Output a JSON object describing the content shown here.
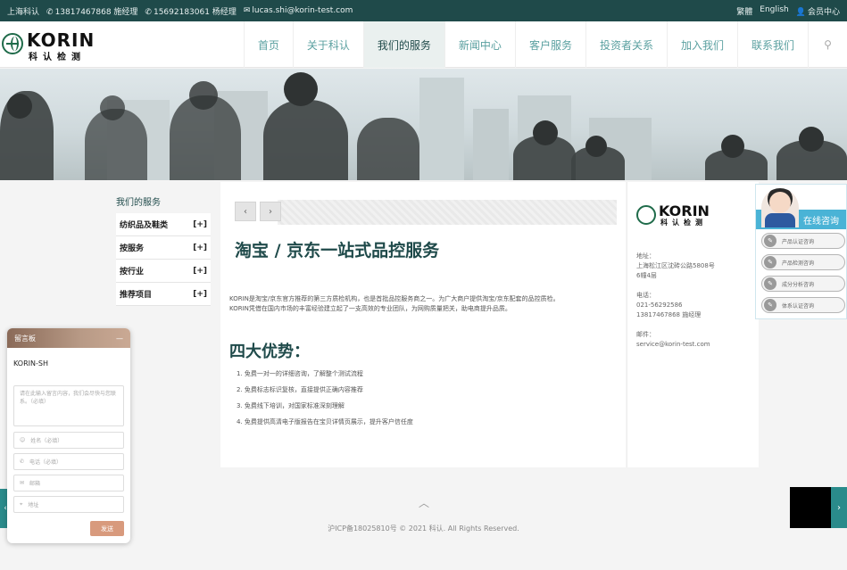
{
  "topbar": {
    "location": "上海科认",
    "phone_1": "13817467868 施经理",
    "phone_2": "15692183061 杨经理",
    "email": "lucas.shi@korin-test.com",
    "lang_traditional": "繁體",
    "lang_english": "English",
    "member_center": "会员中心"
  },
  "logo": {
    "brand": "KORIN",
    "brand_cn": "科认检测"
  },
  "nav": {
    "items": [
      "首页",
      "关于科认",
      "我们的服务",
      "新闻中心",
      "客户服务",
      "投资者关系",
      "加入我们",
      "联系我们"
    ]
  },
  "sidebar": {
    "title": "我们的服务",
    "categories": [
      {
        "label": "纺织品及鞋类",
        "toggle": "[+]"
      },
      {
        "label": "按服务",
        "toggle": "[+]"
      },
      {
        "label": "按行业",
        "toggle": "[+]"
      },
      {
        "label": "推荐项目",
        "toggle": "[+]"
      }
    ]
  },
  "content": {
    "prev": "‹",
    "next": "›",
    "title": "淘宝 / 京东一站式品控服务",
    "intro_1": "KORIN是淘宝/京东官方推荐的第三方质检机构，也是首批品控服务商之一。为广大商户提供淘宝/京东配套的品控质检。",
    "intro_2": "KORIN凭借在国内市场的丰富经验建立起了一支高效的专业团队，为网购质量把关，助电商提升品质。",
    "advantages_title": "四大优势：",
    "advantages": [
      "1. 免费一对一的详细咨询，了解整个测试流程",
      "2. 免费标志标识复核，直接提供正确内容推荐",
      "3. 免费线下培训，对国家标准深刻理解",
      "4. 免费提供高清电子版报告在宝贝详情页展示，提升客户信任度"
    ]
  },
  "info": {
    "address_label": "地址：",
    "address": "上海松江区沈砖公路5808号6幢4层",
    "phone_label": "电话：",
    "phone_1": "021-56292586",
    "phone_2": "13817467868 施经理",
    "email_label": "邮件：",
    "email": "service@korin-test.com"
  },
  "consult": {
    "title": "在线咨询",
    "options": [
      "产品认证咨询",
      "产品检测咨询",
      "成分分析咨询",
      "体系认证咨询"
    ]
  },
  "footer": {
    "up": "︿",
    "copyright": "沪ICP备18025810号 © 2021 科认. All Rights Reserved."
  },
  "msgboard": {
    "title": "留言板",
    "minimize": "—",
    "company": "KORIN-SH",
    "message_placeholder": "请在此输入留言内容，我们会尽快与您联系。（必填）",
    "name_placeholder": "姓名（必填）",
    "phone_placeholder": "电话（必填）",
    "email_placeholder": "邮箱",
    "address_placeholder": "地址",
    "send": "发送"
  },
  "side": {
    "left_arrow": "‹",
    "right_arrow": "›"
  },
  "colors": {
    "topbar": "#1f4a4a",
    "nav_text": "#5aa0a0",
    "accent": "#2a8b8b",
    "consult_bar": "#4ab3d6",
    "send": "#d89a7d"
  }
}
